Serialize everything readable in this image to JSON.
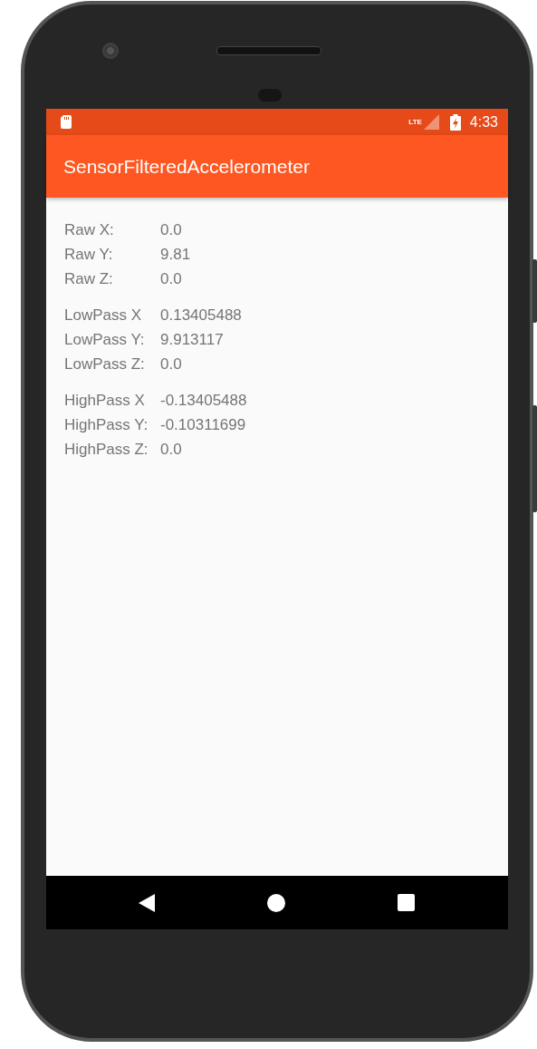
{
  "status_bar": {
    "network": "LTE",
    "time": "4:33"
  },
  "toolbar": {
    "title": "SensorFilteredAccelerometer"
  },
  "groups": [
    {
      "rows": [
        {
          "label": "Raw X:",
          "value": "0.0"
        },
        {
          "label": "Raw Y:",
          "value": "9.81"
        },
        {
          "label": "Raw Z:",
          "value": "0.0"
        }
      ]
    },
    {
      "rows": [
        {
          "label": "LowPass X",
          "value": "0.13405488"
        },
        {
          "label": "LowPass Y:",
          "value": "9.913117"
        },
        {
          "label": "LowPass Z:",
          "value": "0.0"
        }
      ]
    },
    {
      "rows": [
        {
          "label": "HighPass X",
          "value": "-0.13405488"
        },
        {
          "label": "HighPass Y:",
          "value": "-0.10311699"
        },
        {
          "label": "HighPass Z:",
          "value": "0.0"
        }
      ]
    }
  ]
}
